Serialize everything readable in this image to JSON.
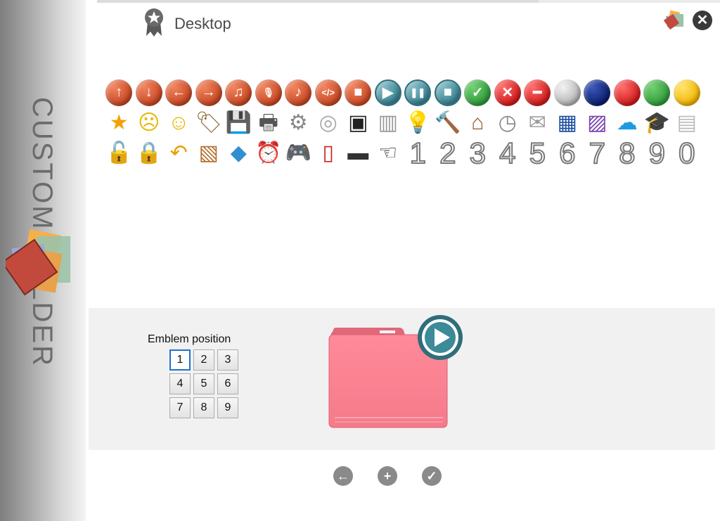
{
  "sidebar": {
    "title": "CUSTOM FOLDER"
  },
  "breadcrumb": {
    "location": "Desktop",
    "icon": "award-ribbon-icon"
  },
  "window": {
    "close_icon": "close-icon",
    "logo_icon": "app-logo-icon"
  },
  "emblems": {
    "row1": [
      {
        "name": "arrow-up",
        "glyph": "↑",
        "style": "orange"
      },
      {
        "name": "arrow-down",
        "glyph": "↓",
        "style": "orange"
      },
      {
        "name": "arrow-left",
        "glyph": "←",
        "style": "orange"
      },
      {
        "name": "arrow-right",
        "glyph": "→",
        "style": "orange"
      },
      {
        "name": "music",
        "glyph": "♫",
        "style": "orange"
      },
      {
        "name": "microphone",
        "glyph": "🎙",
        "style": "orange"
      },
      {
        "name": "note",
        "glyph": "♪",
        "style": "orange"
      },
      {
        "name": "code",
        "glyph": "</>",
        "style": "orange"
      },
      {
        "name": "camera",
        "glyph": "■",
        "style": "orange"
      },
      {
        "name": "play",
        "glyph": "▶",
        "style": "teal"
      },
      {
        "name": "pause",
        "glyph": "❚❚",
        "style": "teal"
      },
      {
        "name": "stop",
        "glyph": "■",
        "style": "teal"
      },
      {
        "name": "check",
        "glyph": "✓",
        "style": "green"
      },
      {
        "name": "cross",
        "glyph": "✕",
        "style": "red"
      },
      {
        "name": "minus",
        "glyph": "━",
        "style": "red"
      },
      {
        "name": "gray-ball",
        "glyph": "",
        "style": "gray"
      },
      {
        "name": "navy-ball",
        "glyph": "",
        "style": "navy"
      },
      {
        "name": "red-ball",
        "glyph": "",
        "style": "red"
      },
      {
        "name": "green-ball",
        "glyph": "",
        "style": "green"
      },
      {
        "name": "yellow-ball",
        "glyph": "",
        "style": "yellow"
      }
    ],
    "row2": [
      {
        "name": "star",
        "glyph": "★",
        "color": "#f2a200"
      },
      {
        "name": "sad-face",
        "glyph": "☹",
        "color": "#e6b800"
      },
      {
        "name": "smiley",
        "glyph": "☺",
        "color": "#e6b800"
      },
      {
        "name": "tag",
        "glyph": "🏷",
        "color": "#8a6d3b"
      },
      {
        "name": "floppy-disk",
        "glyph": "💾",
        "color": "#333"
      },
      {
        "name": "printer",
        "glyph": "🖶",
        "color": "#555"
      },
      {
        "name": "gear",
        "glyph": "⚙",
        "color": "#888"
      },
      {
        "name": "disc",
        "glyph": "◎",
        "color": "#aaa"
      },
      {
        "name": "terminal",
        "glyph": "▣",
        "color": "#222"
      },
      {
        "name": "drawers",
        "glyph": "▥",
        "color": "#999"
      },
      {
        "name": "lightbulb",
        "glyph": "💡",
        "color": "#ccc"
      },
      {
        "name": "hammer",
        "glyph": "🔨",
        "color": "#b8860b"
      },
      {
        "name": "house",
        "glyph": "⌂",
        "color": "#8b5a2b"
      },
      {
        "name": "clock",
        "glyph": "◷",
        "color": "#888"
      },
      {
        "name": "envelope",
        "glyph": "✉",
        "color": "#999"
      },
      {
        "name": "arcade",
        "glyph": "▦",
        "color": "#1c4fa1"
      },
      {
        "name": "picture",
        "glyph": "▨",
        "color": "#7a3fb0"
      },
      {
        "name": "cloud",
        "glyph": "☁",
        "color": "#1e9be0"
      },
      {
        "name": "graduation-cap",
        "glyph": "🎓",
        "color": "#222"
      },
      {
        "name": "notepad",
        "glyph": "▤",
        "color": "#bbb"
      }
    ],
    "row3": [
      {
        "name": "lock-open",
        "glyph": "🔓",
        "color": "#d4a300"
      },
      {
        "name": "lock-closed",
        "glyph": "🔒",
        "color": "#d4a300"
      },
      {
        "name": "return-arrow",
        "glyph": "↶",
        "color": "#e8a000"
      },
      {
        "name": "map",
        "glyph": "▧",
        "color": "#b5702f"
      },
      {
        "name": "puzzle",
        "glyph": "◆",
        "color": "#2f8fd0"
      },
      {
        "name": "alarm",
        "glyph": "⏰",
        "color": "#cc1111"
      },
      {
        "name": "gamepad",
        "glyph": "🎮",
        "color": "#777"
      },
      {
        "name": "book",
        "glyph": "▯",
        "color": "#cc2222"
      },
      {
        "name": "dash",
        "glyph": "▬",
        "color": "#333"
      },
      {
        "name": "hand-pointer",
        "glyph": "☜",
        "color": "#111"
      }
    ],
    "digits": [
      "1",
      "2",
      "3",
      "4",
      "5",
      "6",
      "7",
      "8",
      "9",
      "0"
    ]
  },
  "emblem_position": {
    "label": "Emblem position",
    "cells": [
      "1",
      "2",
      "3",
      "4",
      "5",
      "6",
      "7",
      "8",
      "9"
    ],
    "selected": "1"
  },
  "preview": {
    "folder_color": "#f87a8c",
    "emblem": "play"
  },
  "actions": {
    "back": "back-icon",
    "add": "add-icon",
    "apply": "apply-icon"
  }
}
